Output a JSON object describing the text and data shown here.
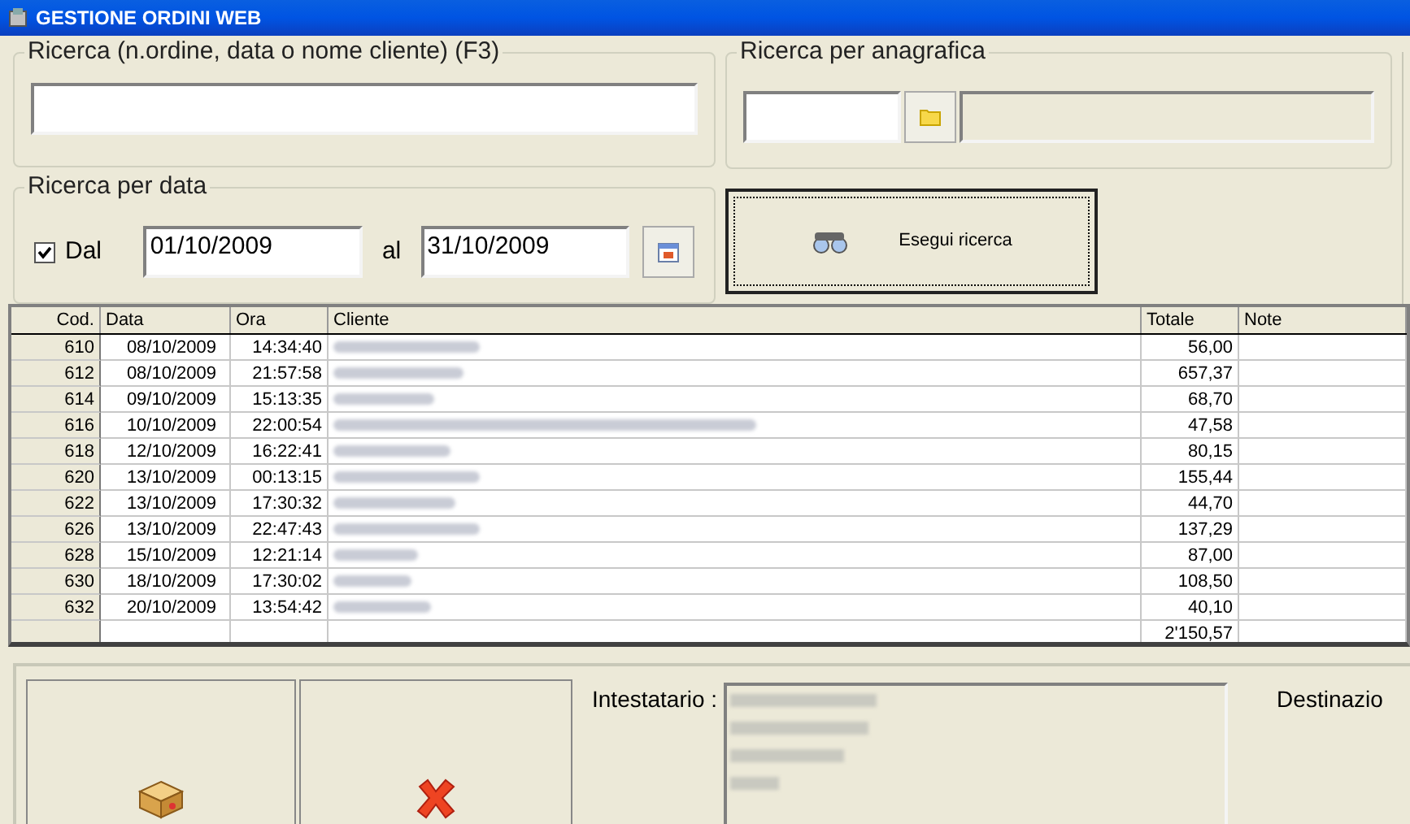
{
  "window": {
    "title": "GESTIONE ORDINI WEB"
  },
  "search": {
    "label": "Ricerca (n.ordine, data o nome cliente) (F3)"
  },
  "registry_search": {
    "label": "Ricerca per anagrafica"
  },
  "date_search": {
    "label": "Ricerca per data",
    "from_checkbox": {
      "label": "Dal",
      "checked": true
    },
    "from": "01/10/2009",
    "to_label": "al",
    "to": "31/10/2009"
  },
  "run_search_button": {
    "label": "Esegui ricerca"
  },
  "table": {
    "columns": [
      "Cod.",
      "Data",
      "Ora",
      "Cliente",
      "Totale",
      "Note"
    ],
    "rows": [
      {
        "cod": "610",
        "data": "08/10/2009",
        "ora": "14:34:40",
        "totale": "56,00"
      },
      {
        "cod": "612",
        "data": "08/10/2009",
        "ora": "21:57:58",
        "totale": "657,37"
      },
      {
        "cod": "614",
        "data": "09/10/2009",
        "ora": "15:13:35",
        "totale": "68,70"
      },
      {
        "cod": "616",
        "data": "10/10/2009",
        "ora": "22:00:54",
        "totale": "47,58"
      },
      {
        "cod": "618",
        "data": "12/10/2009",
        "ora": "16:22:41",
        "totale": "80,15"
      },
      {
        "cod": "620",
        "data": "13/10/2009",
        "ora": "00:13:15",
        "totale": "155,44"
      },
      {
        "cod": "622",
        "data": "13/10/2009",
        "ora": "17:30:32",
        "totale": "44,70"
      },
      {
        "cod": "626",
        "data": "13/10/2009",
        "ora": "22:47:43",
        "totale": "137,29"
      },
      {
        "cod": "628",
        "data": "15/10/2009",
        "ora": "12:21:14",
        "totale": "87,00"
      },
      {
        "cod": "630",
        "data": "18/10/2009",
        "ora": "17:30:02",
        "totale": "108,50"
      },
      {
        "cod": "632",
        "data": "20/10/2009",
        "ora": "13:54:42",
        "totale": "40,10"
      }
    ],
    "total": "2'150,57"
  },
  "details": {
    "holder_label": "Intestatario :",
    "destination_label": "Destinazio"
  }
}
